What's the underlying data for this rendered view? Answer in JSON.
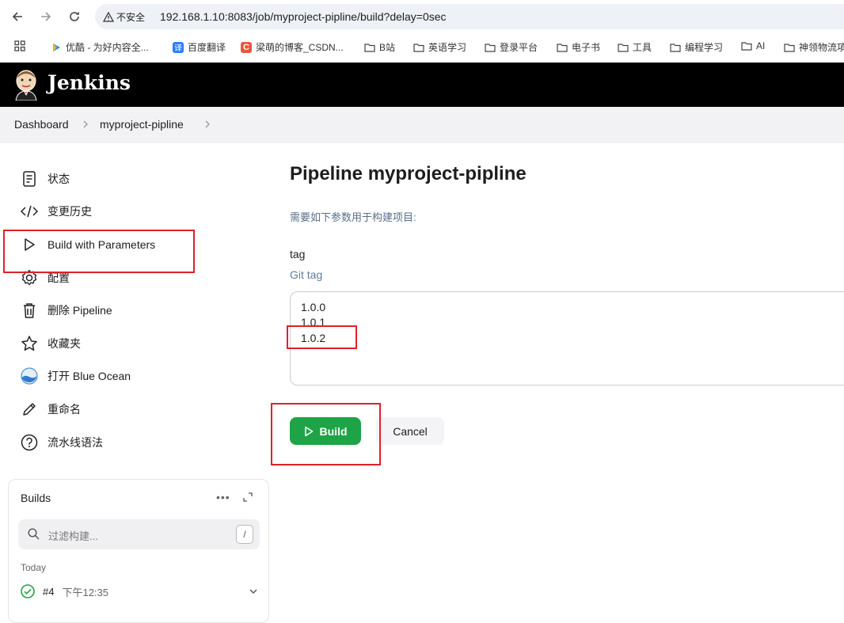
{
  "browser": {
    "security_label": "不安全",
    "url": "192.168.1.10:8083/job/myproject-pipline/build?delay=0sec",
    "bookmarks": [
      {
        "label": "优酷 - 为好内容全...",
        "icon": "youku-icon"
      },
      {
        "label": "百度翻译",
        "icon": "baidu-translate-icon"
      },
      {
        "label": "梁萌的博客_CSDN...",
        "icon": "csdn-icon"
      },
      {
        "label": "B站",
        "icon": "folder-icon"
      },
      {
        "label": "英语学习",
        "icon": "folder-icon"
      },
      {
        "label": "登录平台",
        "icon": "folder-icon"
      },
      {
        "label": "电子书",
        "icon": "folder-icon"
      },
      {
        "label": "工具",
        "icon": "folder-icon"
      },
      {
        "label": "编程学习",
        "icon": "folder-icon"
      },
      {
        "label": "AI",
        "icon": "folder-icon"
      },
      {
        "label": "神领物流項",
        "icon": "folder-icon"
      }
    ]
  },
  "header": {
    "title": "Jenkins"
  },
  "breadcrumbs": [
    "Dashboard",
    "myproject-pipline"
  ],
  "sidebar": {
    "items": [
      {
        "label": "状态",
        "icon": "status-icon"
      },
      {
        "label": "变更历史",
        "icon": "code-icon"
      },
      {
        "label": "Build with Parameters",
        "icon": "play-icon"
      },
      {
        "label": "配置",
        "icon": "gear-icon"
      },
      {
        "label": "删除 Pipeline",
        "icon": "trash-icon"
      },
      {
        "label": "收藏夹",
        "icon": "star-icon"
      },
      {
        "label": "打开 Blue Ocean",
        "icon": "blue-ocean-icon"
      },
      {
        "label": "重命名",
        "icon": "pencil-icon"
      },
      {
        "label": "流水线语法",
        "icon": "help-icon"
      }
    ]
  },
  "builds": {
    "title": "Builds",
    "filter_placeholder": "过滤构建...",
    "filter_shortcut": "/",
    "group_label": "Today",
    "items": [
      {
        "number": "#4",
        "time": "下午12:35",
        "status": "success"
      }
    ]
  },
  "main": {
    "title": "Pipeline myproject-pipline",
    "description": "需要如下参数用于构建项目:",
    "parameter": {
      "name": "tag",
      "description": "Git tag",
      "options": [
        "1.0.0",
        "1.0.1",
        "1.0.2"
      ],
      "selected": "1.0.2"
    },
    "build_label": "Build",
    "cancel_label": "Cancel"
  },
  "colors": {
    "build_button": "#1ea446",
    "annotation_red": "#e0202a",
    "header_bg": "#000000",
    "success_green": "#1ea446"
  }
}
